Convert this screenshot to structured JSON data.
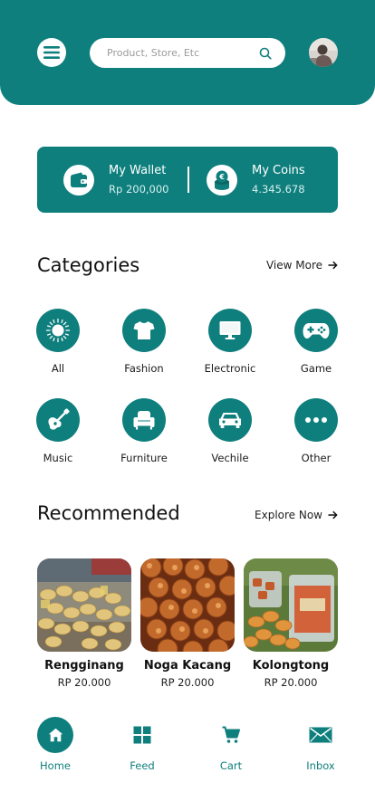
{
  "header": {
    "search_placeholder": "Product, Store, Etc",
    "menu_icon": "hamburger-menu-icon",
    "search_icon": "search-icon",
    "avatar_icon": "user-avatar"
  },
  "wallet": {
    "title": "My Wallet",
    "amount": "Rp 200,000",
    "icon": "wallet-icon"
  },
  "coins": {
    "title": "My Coins",
    "amount": "4.345.678",
    "icon": "coins-icon"
  },
  "categories": {
    "title": "Categories",
    "view_more": "View More",
    "items": [
      {
        "label": "All",
        "icon": "sun-icon"
      },
      {
        "label": "Fashion",
        "icon": "tshirt-icon"
      },
      {
        "label": "Electronic",
        "icon": "monitor-icon"
      },
      {
        "label": "Game",
        "icon": "gamepad-icon"
      },
      {
        "label": "Music",
        "icon": "guitar-icon"
      },
      {
        "label": "Furniture",
        "icon": "armchair-icon"
      },
      {
        "label": "Vechile",
        "icon": "car-icon"
      },
      {
        "label": "Other",
        "icon": "more-dots-icon"
      }
    ]
  },
  "recommended": {
    "title": "Recommended",
    "explore": "Explore Now",
    "items": [
      {
        "name": "Rengginang",
        "price": "RP 20.000"
      },
      {
        "name": "Noga Kacang",
        "price": "RP 20.000"
      },
      {
        "name": "Kolongtong",
        "price": "RP 20.000"
      }
    ]
  },
  "nav": {
    "items": [
      {
        "label": "Home",
        "icon": "home-icon"
      },
      {
        "label": "Feed",
        "icon": "grid-icon"
      },
      {
        "label": "Cart",
        "icon": "cart-icon"
      },
      {
        "label": "Inbox",
        "icon": "mail-icon"
      }
    ]
  },
  "colors": {
    "primary": "#0e7f7d",
    "background": "#ffffff",
    "text": "#1b1b1b"
  }
}
